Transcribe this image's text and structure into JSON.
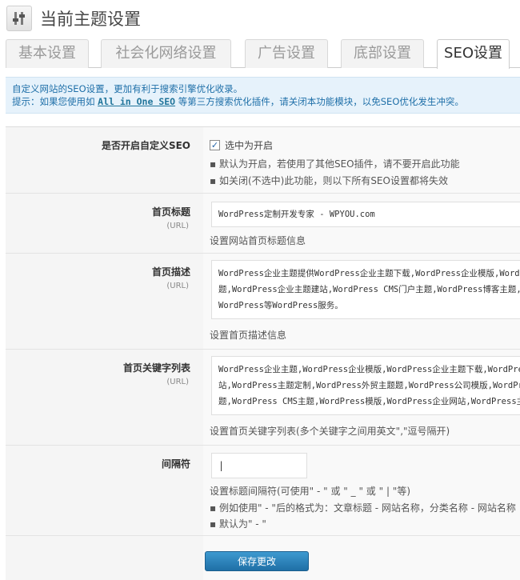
{
  "header": {
    "title": "当前主题设置",
    "icon": "settings-sliders-icon"
  },
  "tabs": [
    {
      "label": "基本设置",
      "active": false
    },
    {
      "label": "社会化网络设置",
      "active": false
    },
    {
      "label": "广告设置",
      "active": false
    },
    {
      "label": "底部设置",
      "active": false
    },
    {
      "label": "SEO设置",
      "active": true
    }
  ],
  "notice": {
    "line1": "自定义网站的SEO设置，更加有利于搜索引擎优化收录。",
    "line2_prefix": "提示：如果您使用如",
    "plugin_name": "All in One SEO",
    "line2_suffix": "等第三方搜索优化插件，请关闭本功能模块，以免SEO优化发生冲突。"
  },
  "fields": {
    "seo_enable": {
      "label": "是否开启自定义SEO",
      "checkbox_label": "选中为开启",
      "checked": true,
      "notes": [
        "默认为开启，若使用了其他SEO插件，请不要开启此功能",
        "如关闭(不选中)此功能，则以下所有SEO设置都将失效"
      ]
    },
    "home_title": {
      "label": "首页标题",
      "sublabel": "(URL)",
      "value": "WordPress定制开发专家 - WPYOU.com",
      "description": "设置网站首页标题信息"
    },
    "home_description": {
      "label": "首页描述",
      "sublabel": "(URL)",
      "lines": [
        "WordPress企业主题提供WordPress企业主题下载,WordPress企业模版,WordPress",
        "题,WordPress企业主题建站,WordPress CMS门户主题,WordPress博客主题,",
        "WordPress等WordPress服务。"
      ],
      "description": "设置首页描述信息"
    },
    "home_keywords": {
      "label": "首页关键字列表",
      "sublabel": "(URL)",
      "lines": [
        "WordPress企业主题,WordPress企业模版,WordPress企业主题下载,WordPress",
        "站,WordPress主题定制,WordPress外贸主题题,WordPress公司模版,WordPress",
        "题,WordPress CMS主题,WordPress模版,WordPress企业网站,WordPress主"
      ],
      "description": "设置首页关键字列表(多个关键字之间用英文\",\"逗号隔开)"
    },
    "separator": {
      "label": "间隔符",
      "value": "|",
      "description": "设置标题间隔符(可使用\" - \" 或 \" _ \" 或 \" | \"等)",
      "notes": [
        "例如使用\" - \"后的格式为：文章标题 - 网站名称，分类名称 - 网站名称",
        "默认为\" - \""
      ]
    }
  },
  "save_button": {
    "label": "保存更改"
  },
  "colors": {
    "accent": "#21759b",
    "button": "#2a7fb8",
    "notice_bg": "#e6f2fb"
  }
}
